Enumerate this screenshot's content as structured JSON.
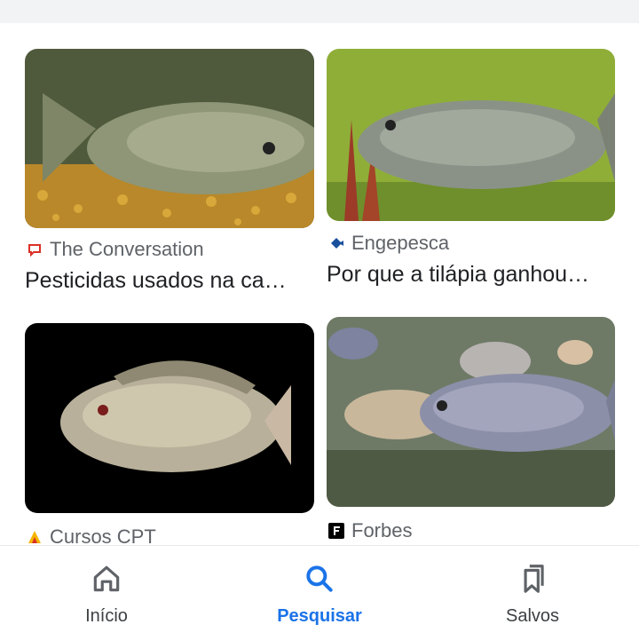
{
  "results": [
    {
      "source": "The Conversation",
      "title": "Pesticidas usados na ca…",
      "source_icon": "speech-bubble-icon",
      "accent": "#d93025"
    },
    {
      "source": "Engepesca",
      "title": "Por que a tilápia ganhou…",
      "source_icon": "fish-logo-icon",
      "accent": "#1a4f9c"
    },
    {
      "source": "Cursos CPT",
      "title": "",
      "source_icon": "cpt-logo-icon",
      "accent": "#f5b400"
    },
    {
      "source": "Forbes",
      "title": "",
      "source_icon": "forbes-logo-icon",
      "accent": "#000000"
    }
  ],
  "nav": {
    "items": [
      {
        "label": "Início",
        "icon": "home-icon"
      },
      {
        "label": "Pesquisar",
        "icon": "search-icon"
      },
      {
        "label": "Salvos",
        "icon": "bookmarks-icon"
      }
    ],
    "active_color": "#1a73e8"
  }
}
